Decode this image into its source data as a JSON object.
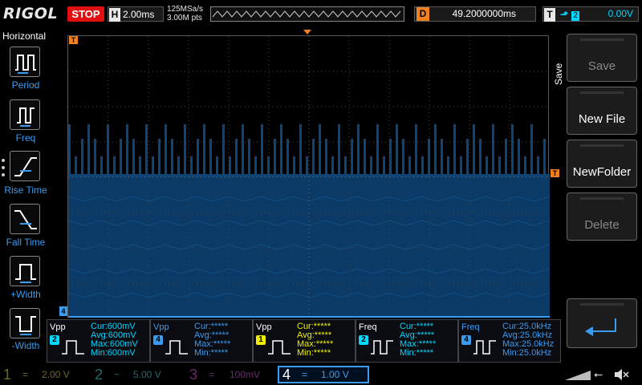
{
  "brand": "RIGOL",
  "run_state": "STOP",
  "timebase": {
    "label": "H",
    "value": "2.00ms"
  },
  "acquisition": {
    "sample_rate": "125MSa/s",
    "points": "3.00M pts"
  },
  "delay": {
    "label": "D",
    "value": "49.2000000ms"
  },
  "trigger": {
    "label": "T",
    "source": "2",
    "level": "0.00V"
  },
  "left_menu": {
    "title": "Horizontal",
    "items": [
      {
        "label": "Period"
      },
      {
        "label": "Freq"
      },
      {
        "label": "Rise Time"
      },
      {
        "label": "Fall Time"
      },
      {
        "label": "+Width"
      },
      {
        "label": "-Width"
      }
    ]
  },
  "right_menu": {
    "title": "Save",
    "buttons": [
      {
        "label": "Save",
        "enabled": false
      },
      {
        "label": "New File",
        "enabled": true
      },
      {
        "label": "NewFolder",
        "enabled": true
      },
      {
        "label": "Delete",
        "enabled": false
      }
    ]
  },
  "measurements": [
    {
      "name": "Vpp",
      "channel": "2",
      "color": "#00d8ff",
      "cur": "Cur:600mV",
      "avg": "Avg:600mV",
      "max": "Max:600mV",
      "min": "Min:600mV"
    },
    {
      "name": "Vpp",
      "channel": "4",
      "color": "#3a9cf0",
      "cur": "Cur:*****",
      "avg": "Avg:*****",
      "max": "Max:*****",
      "min": "Min:*****"
    },
    {
      "name": "Vpp",
      "channel": "1",
      "color": "#f0f000",
      "cur": "Cur:*****",
      "avg": "Avg:*****",
      "max": "Max:*****",
      "min": "Min:*****"
    },
    {
      "name": "Freq",
      "channel": "2",
      "color": "#00d8ff",
      "cur": "Cur:*****",
      "avg": "Avg:*****",
      "max": "Max:*****",
      "min": "Min:*****"
    },
    {
      "name": "Freq",
      "channel": "4",
      "color": "#3a9cf0",
      "cur": "Cur:25.0kHz",
      "avg": "Avg:25.0kHz",
      "max": "Max:25.0kHz",
      "min": "Min:25.0kHz"
    }
  ],
  "channels": [
    {
      "num": "1",
      "coupling": "=",
      "scale": "2.00 V",
      "color": "#6b6b20",
      "active": false
    },
    {
      "num": "2",
      "coupling": "~",
      "scale": "5.00 V",
      "color": "#1f6a6a",
      "active": false
    },
    {
      "num": "3",
      "coupling": "=",
      "scale": "100mV",
      "color": "#6a2a6a",
      "active": false
    },
    {
      "num": "4",
      "coupling": "=",
      "scale": "1.00 V",
      "color": "#3a9cf0",
      "active": true
    }
  ],
  "markers": {
    "trigger_edge": "T",
    "ground_ref": "4"
  },
  "colors": {
    "ch1": "#f0f000",
    "ch2": "#00d8ff",
    "ch3": "#e040e0",
    "ch4": "#3a9cf0",
    "trigger": "#f08020",
    "stop": "#e01010"
  }
}
